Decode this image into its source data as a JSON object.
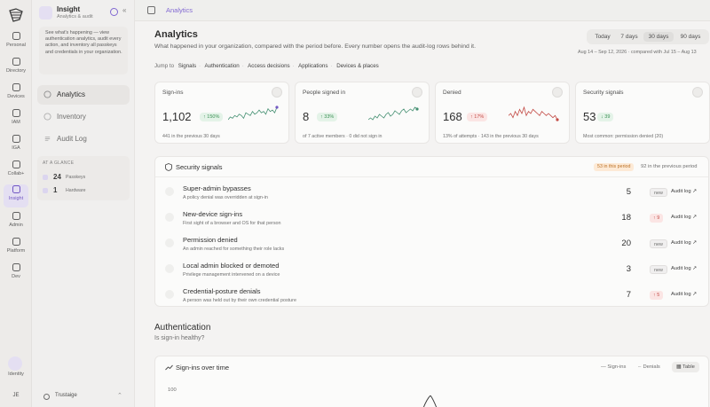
{
  "rail": {
    "items": [
      {
        "label": "Personal",
        "icon": "person-icon"
      },
      {
        "label": "Directory",
        "icon": "directory-icon"
      },
      {
        "label": "Devices",
        "icon": "devices-icon"
      },
      {
        "label": "IAM",
        "icon": "shield-icon"
      },
      {
        "label": "IGA",
        "icon": "key-icon"
      },
      {
        "label": "Collab+",
        "icon": "collab-icon"
      },
      {
        "label": "Insight",
        "icon": "chart-icon"
      },
      {
        "label": "Admin",
        "icon": "gear-icon"
      },
      {
        "label": "Platform",
        "icon": "platform-icon"
      },
      {
        "label": "Dev",
        "icon": "wrench-icon"
      }
    ],
    "identity_label": "Identity",
    "avatar_initials": "JE"
  },
  "sidebar": {
    "app_title": "Insight",
    "app_subtitle": "Analytics & audit",
    "collapse_glyph": "«",
    "intro": "See what's happening — view authentication analytics, audit every action, and inventory all passkeys and credentials in your organization.",
    "nav": [
      {
        "label": "Analytics",
        "icon": "analytics-icon"
      },
      {
        "label": "Inventory",
        "icon": "inventory-icon"
      },
      {
        "label": "Audit Log",
        "icon": "audit-log-icon"
      }
    ],
    "glance": {
      "heading": "AT A GLANCE",
      "items": [
        {
          "count": "24",
          "label": "Passkeys"
        },
        {
          "count": "1",
          "label": "Hardware"
        }
      ]
    },
    "org_name": "Trustaige",
    "org_chevron": "⌃"
  },
  "topbar": {
    "breadcrumb": "Analytics"
  },
  "header": {
    "title": "Analytics",
    "subtitle": "What happened in your organization, compared with the period before. Every number opens the audit-log rows behind it.",
    "jump_label": "Jump to",
    "jump_links": [
      "Signals",
      "Authentication",
      "Access decisions",
      "Applications",
      "Devices & places"
    ],
    "range_options": [
      "Today",
      "7 days",
      "30 days",
      "90 days"
    ],
    "range_selected": "30 days",
    "compare_text": "Aug 14 – Sep 12, 2026 · compared with Jul 15 – Aug 13"
  },
  "kpis": [
    {
      "title": "Sign-ins",
      "value": "1,102",
      "delta": "↑ 150%",
      "delta_kind": "up",
      "footer": "441 in the previous 30 days",
      "spark": [
        5,
        7,
        6,
        8,
        7,
        9,
        8,
        6,
        10,
        9,
        8,
        11,
        9,
        10,
        12,
        10,
        11,
        9,
        13,
        11,
        12,
        10,
        14
      ],
      "spark_color": "#3a8a6a",
      "dot_color": "#6a4ec0",
      "icon": "sign-in-icon"
    },
    {
      "title": "People signed in",
      "value": "8",
      "delta": "↑ 33%",
      "delta_kind": "up",
      "footer": "of 7 active members · 0 did not sign in",
      "spark": [
        4,
        5,
        4,
        6,
        5,
        7,
        6,
        5,
        7,
        8,
        6,
        7,
        9,
        8,
        7,
        9,
        10,
        8,
        9,
        10,
        9,
        11,
        10
      ],
      "spark_color": "#3a8a6a",
      "dot_color": "#3a8a6a",
      "icon": "people-icon"
    },
    {
      "title": "Denied",
      "value": "168",
      "delta": "↑ 17%",
      "delta_kind": "bad",
      "footer": "13% of attempts · 143 in the previous 30 days",
      "spark": [
        8,
        9,
        7,
        10,
        8,
        11,
        9,
        12,
        8,
        10,
        9,
        11,
        10,
        9,
        8,
        10,
        9,
        8,
        9,
        8,
        7,
        8,
        6
      ],
      "spark_color": "#c0403a",
      "dot_color": "#c0403a",
      "icon": "denied-icon"
    },
    {
      "title": "Security signals",
      "value": "53",
      "delta": "↓ 39",
      "delta_kind": "up",
      "footer": "Most common: permission denied (20)",
      "spark": [],
      "spark_color": "#3a8a6a",
      "dot_color": "#3a8a6a",
      "icon": "signal-icon"
    }
  ],
  "signals": {
    "title": "Security signals",
    "period_badge": "53 in this period",
    "previous": "92 in the previous period",
    "rows": [
      {
        "title": "Super-admin bypasses",
        "desc": "A policy denial was overridden at sign-in",
        "count": "5",
        "badge": "new",
        "badge_kind": "new",
        "link": "Audit log ↗",
        "icon": "bypass-icon"
      },
      {
        "title": "New-device sign-ins",
        "desc": "First sight of a browser and OS for that person",
        "count": "18",
        "badge": "↑ 9",
        "badge_kind": "bad",
        "link": "Audit log ↗",
        "icon": "device-icon"
      },
      {
        "title": "Permission denied",
        "desc": "An admin reached for something their role lacks",
        "count": "20",
        "badge": "new",
        "badge_kind": "new",
        "link": "Audit log ↗",
        "icon": "blocked-icon"
      },
      {
        "title": "Local admin blocked or demoted",
        "desc": "Privilege management intervened on a device",
        "count": "3",
        "badge": "new",
        "badge_kind": "new",
        "link": "Audit log ↗",
        "icon": "laptop-icon"
      },
      {
        "title": "Credential-posture denials",
        "desc": "A person was held out by their own credential posture",
        "count": "7",
        "badge": "↑ 5",
        "badge_kind": "bad",
        "link": "Audit log ↗",
        "icon": "credential-icon"
      }
    ]
  },
  "auth": {
    "title": "Authentication",
    "subtitle": "Is sign-in healthy?",
    "chart_title": "Sign-ins over time",
    "legend": [
      "Sign-ins",
      "Denials"
    ],
    "table_label": "Table",
    "y_tick": "100"
  }
}
